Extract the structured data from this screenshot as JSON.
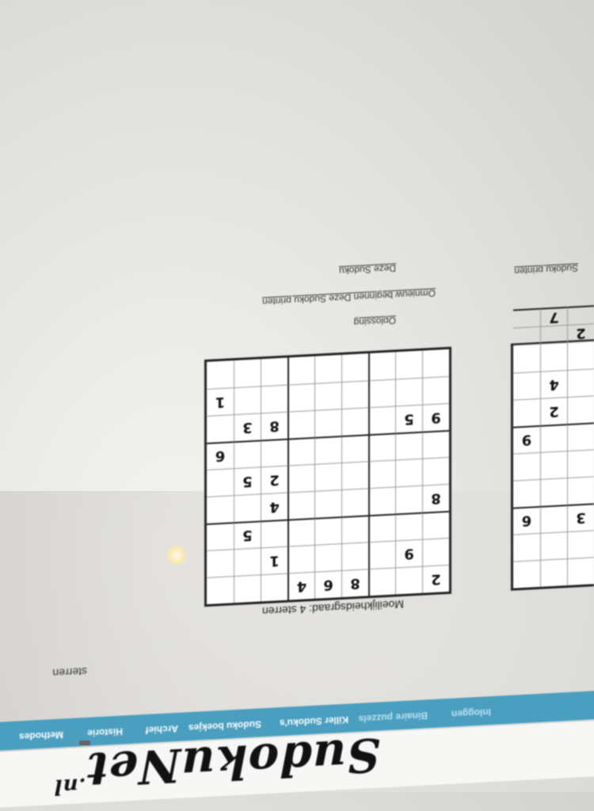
{
  "site": {
    "logo_text": "SudokuNet",
    "logo_suffix": ".nl"
  },
  "nav": {
    "items": [
      "Methodes",
      "Historie",
      "Archief",
      "Sudoku boekjes",
      "Killer Sudoku's",
      "Binaire puzzels",
      "Inloggen"
    ]
  },
  "left_puzzle": {
    "caption": "sterren",
    "print_link": "Sudoku printen",
    "cells": [
      "",
      "",
      "",
      "",
      "",
      "",
      "3",
      "",
      "6",
      "",
      "",
      "",
      "",
      "",
      "",
      "",
      "",
      "9",
      "",
      "2",
      "",
      "",
      "4",
      "",
      "",
      "",
      "",
      "",
      "",
      "",
      "2",
      "",
      "",
      "",
      "7",
      ""
    ]
  },
  "main_puzzle": {
    "difficulty_label": "Moeilijkheidsgraad: 4 sterren",
    "cells": [
      "2",
      "",
      "",
      "8",
      "6",
      "4",
      "",
      "",
      "",
      "",
      "9",
      "",
      "",
      "",
      "",
      "1",
      "",
      "",
      "",
      "",
      "",
      "",
      "",
      "",
      "",
      "5",
      "",
      "8",
      "",
      "",
      "",
      "",
      "",
      "4",
      "",
      "",
      "",
      "",
      "",
      "",
      "",
      "",
      "2",
      "5",
      "",
      "",
      "",
      "",
      "",
      "",
      "",
      "",
      "",
      "6",
      "9",
      "5",
      "",
      "",
      "",
      "",
      "8",
      "3",
      "",
      "",
      "",
      "",
      "",
      "",
      "",
      "",
      "",
      "1",
      "",
      "",
      "",
      "",
      "",
      "",
      "",
      "",
      ""
    ],
    "solution_link": "Oplossing",
    "print_links": "Omnieuw beginnen   Deze Sudoku printen",
    "easy_link": "Deze Sudoku"
  }
}
